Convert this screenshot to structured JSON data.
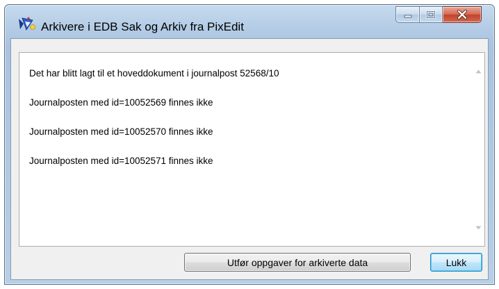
{
  "window": {
    "title": "Arkivere i EDB Sak og Arkiv fra PixEdit",
    "icon": "pixedit-app-icon"
  },
  "controls": {
    "minimize_icon": "minimize-icon",
    "maximize_icon": "maximize-icon",
    "close_icon": "close-icon"
  },
  "messages": [
    "Det har blitt lagt til et hoveddokument i journalpost 52568/10",
    "Journalposten med id=10052569 finnes ikke",
    "Journalposten med id=10052570 finnes ikke",
    "Journalposten med id=10052571 finnes ikke"
  ],
  "buttons": {
    "archive_tasks": "Utfør oppgaver for arkiverte data",
    "close": "Lukk"
  },
  "colors": {
    "title_bar": "#b5cde6",
    "close_button": "#c0432b",
    "default_button_border": "#3c7fb1"
  }
}
